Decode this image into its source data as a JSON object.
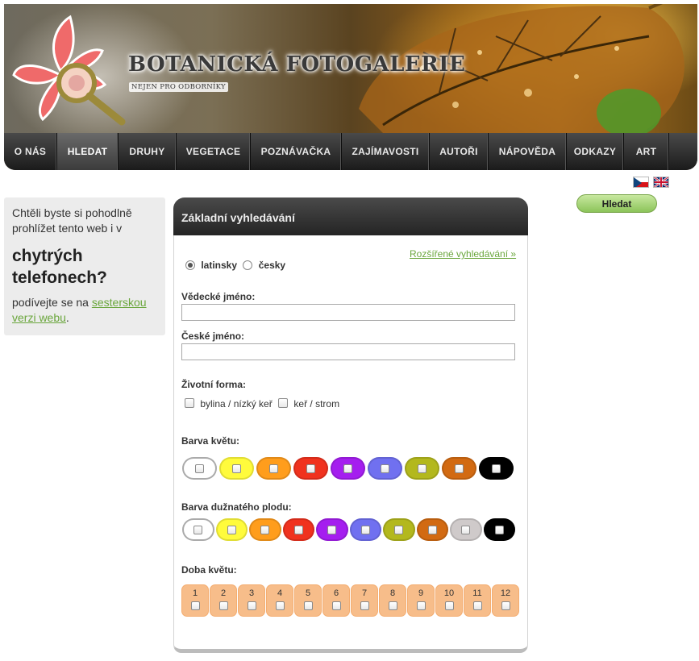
{
  "header": {
    "title": "BOTANICKÁ FOTOGALERIE",
    "subtitle": "NEJEN PRO ODBORNÍKY"
  },
  "nav": [
    {
      "label": "O NÁS",
      "active": false
    },
    {
      "label": "HLEDAT",
      "active": true
    },
    {
      "label": "DRUHY",
      "active": false
    },
    {
      "label": "VEGETACE",
      "active": false
    },
    {
      "label": "POZNÁVAČKA",
      "active": false
    },
    {
      "label": "ZAJÍMAVOSTI",
      "active": false
    },
    {
      "label": "AUTOŘI",
      "active": false
    },
    {
      "label": "NÁPOVĚDA",
      "active": false
    },
    {
      "label": "ODKAZY",
      "active": false
    },
    {
      "label": "ART",
      "active": false
    }
  ],
  "languages": [
    "cz-flag-icon",
    "uk-flag-icon"
  ],
  "promo": {
    "intro": "Chtěli byste si pohodlně prohlížet tento web i v",
    "big": "chytrých telefonech?",
    "outro_prefix": "podívejte se na ",
    "link": "sesterskou verzi webu",
    "outro_suffix": "."
  },
  "search_button": "Hledat",
  "panel": {
    "title": "Základní vyhledávání",
    "advanced_link": "Rozšířené vyhledávání »",
    "lang_options": [
      {
        "label": "latinsky",
        "checked": true
      },
      {
        "label": "česky",
        "checked": false
      }
    ],
    "scientific_name_label": "Vědecké jméno:",
    "scientific_name_value": "",
    "czech_name_label": "České jméno:",
    "czech_name_value": "",
    "life_form_label": "Životní forma:",
    "life_form_options": [
      {
        "label": "bylina / nízký keř",
        "checked": false
      },
      {
        "label": "keř / strom",
        "checked": false
      }
    ],
    "flower_color_label": "Barva květu:",
    "flower_colors": [
      "#ffffff",
      "#fffb3c",
      "#ff9d1c",
      "#f0321e",
      "#a51eef",
      "#7070f0",
      "#b3b81d",
      "#d26a12",
      "#000000"
    ],
    "fruit_color_label": "Barva dužnatého plodu:",
    "fruit_colors": [
      "#ffffff",
      "#fffb3c",
      "#ff9d1c",
      "#f0321e",
      "#a51eef",
      "#7070f0",
      "#b3b81d",
      "#d26a12",
      "#cfcaca",
      "#000000"
    ],
    "bloom_label": "Doba květu:",
    "months": [
      "1",
      "2",
      "3",
      "4",
      "5",
      "6",
      "7",
      "8",
      "9",
      "10",
      "11",
      "12"
    ]
  }
}
